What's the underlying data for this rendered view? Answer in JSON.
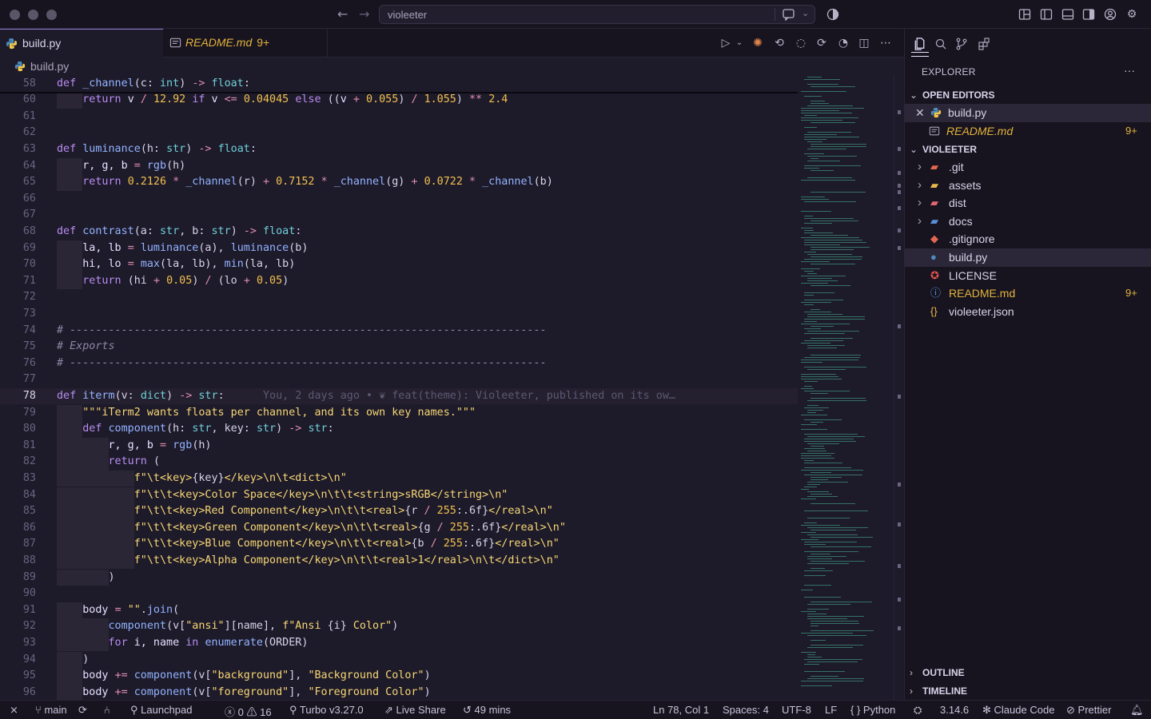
{
  "window": {
    "search_text": "violeeter"
  },
  "tabs": [
    {
      "label": "build.py",
      "active": true
    },
    {
      "label": "README.md",
      "badge": "9+",
      "active": false
    }
  ],
  "breadcrumb": {
    "file": "build.py"
  },
  "code_lines": [
    {
      "n": "58",
      "sticky": true,
      "html": "<span class=\"k\">def</span> <span class=\"f\">_channel</span><span class=\"p\">(c: </span><span class=\"b\">int</span><span class=\"p\">) </span><span class=\"o\">-&gt;</span> <span class=\"b\">float</span><span class=\"p\">:</span>"
    },
    {
      "n": "60",
      "html": "    <span class=\"k\">return</span> <span class=\"t\">v</span> <span class=\"o\">/</span> <span class=\"n\">12.92</span> <span class=\"k\">if</span> <span class=\"t\">v</span> <span class=\"o\">&lt;=</span> <span class=\"n\">0.04045</span> <span class=\"k\">else</span> <span class=\"p\">((</span><span class=\"t\">v</span> <span class=\"o\">+</span> <span class=\"n\">0.055</span><span class=\"p\">)</span> <span class=\"o\">/</span> <span class=\"n\">1.055</span><span class=\"p\">)</span> <span class=\"o\">**</span> <span class=\"n\">2.4</span>"
    },
    {
      "n": "61",
      "html": ""
    },
    {
      "n": "62",
      "html": ""
    },
    {
      "n": "63",
      "html": "<span class=\"k\">def</span> <span class=\"f\">luminance</span><span class=\"p\">(h: </span><span class=\"b\">str</span><span class=\"p\">) </span><span class=\"o\">-&gt;</span> <span class=\"b\">float</span><span class=\"p\">:</span>"
    },
    {
      "n": "64",
      "html": "    <span class=\"t\">r, g, b</span> <span class=\"o\">=</span> <span class=\"f\">rgb</span><span class=\"p\">(h)</span>"
    },
    {
      "n": "65",
      "html": "    <span class=\"k\">return</span> <span class=\"n\">0.2126</span> <span class=\"o\">*</span> <span class=\"f\">_channel</span><span class=\"p\">(r)</span> <span class=\"o\">+</span> <span class=\"n\">0.7152</span> <span class=\"o\">*</span> <span class=\"f\">_channel</span><span class=\"p\">(g)</span> <span class=\"o\">+</span> <span class=\"n\">0.0722</span> <span class=\"o\">*</span> <span class=\"f\">_channel</span><span class=\"p\">(b)</span>"
    },
    {
      "n": "66",
      "html": ""
    },
    {
      "n": "67",
      "html": ""
    },
    {
      "n": "68",
      "html": "<span class=\"k\">def</span> <span class=\"f\">contrast</span><span class=\"p\">(a: </span><span class=\"b\">str</span><span class=\"p\">, b: </span><span class=\"b\">str</span><span class=\"p\">) </span><span class=\"o\">-&gt;</span> <span class=\"b\">float</span><span class=\"p\">:</span>"
    },
    {
      "n": "69",
      "html": "    <span class=\"t\">la, lb</span> <span class=\"o\">=</span> <span class=\"f\">luminance</span><span class=\"p\">(a), </span><span class=\"f\">luminance</span><span class=\"p\">(b)</span>"
    },
    {
      "n": "70",
      "html": "    <span class=\"t\">hi, lo</span> <span class=\"o\">=</span> <span class=\"f\">max</span><span class=\"p\">(la, lb), </span><span class=\"f\">min</span><span class=\"p\">(la, lb)</span>"
    },
    {
      "n": "71",
      "html": "    <span class=\"k\">return</span> <span class=\"p\">(hi </span><span class=\"o\">+</span> <span class=\"n\">0.05</span><span class=\"p\">) </span><span class=\"o\">/</span> <span class=\"p\">(lo </span><span class=\"o\">+</span> <span class=\"n\">0.05</span><span class=\"p\">)</span>"
    },
    {
      "n": "72",
      "html": ""
    },
    {
      "n": "73",
      "html": ""
    },
    {
      "n": "74",
      "html": "<span class=\"c\"># --------------------------------------------------------------------------</span>"
    },
    {
      "n": "75",
      "html": "<span class=\"c\"># Exports</span>"
    },
    {
      "n": "76",
      "html": "<span class=\"c\"># --------------------------------------------------------------------------</span>"
    },
    {
      "n": "77",
      "html": ""
    },
    {
      "n": "78",
      "current": true,
      "html": "<span class=\"k\">def</span> <span class=\"f\">iterm</span><span class=\"p\">(v: </span><span class=\"b\">dict</span><span class=\"p\">) </span><span class=\"o\">-&gt;</span> <span class=\"b\">str</span><span class=\"p\">:</span>      <span class=\"blame\">You, 2 days ago • ❦ feat(theme): Violeeter, published on its ow…</span>"
    },
    {
      "n": "79",
      "html": "    <span class=\"s\">\"\"\"iTerm2 wants floats per channel, and its own key names.\"\"\"</span>"
    },
    {
      "n": "80",
      "html": "    <span class=\"k\">def</span> <span class=\"f\">component</span><span class=\"p\">(h: </span><span class=\"b\">str</span><span class=\"p\">, key: </span><span class=\"b\">str</span><span class=\"p\">) </span><span class=\"o\">-&gt;</span> <span class=\"b\">str</span><span class=\"p\">:</span>"
    },
    {
      "n": "81",
      "html": "        <span class=\"t\">r, g, b</span> <span class=\"o\">=</span> <span class=\"f\">rgb</span><span class=\"p\">(h)</span>"
    },
    {
      "n": "82",
      "html": "        <span class=\"k\">return</span> <span class=\"p\">(</span>"
    },
    {
      "n": "83",
      "html": "            <span class=\"s\">f\"\\t&lt;key&gt;</span><span class=\"p\">{key}</span><span class=\"s\">&lt;/key&gt;\\n\\t&lt;dict&gt;\\n\"</span>"
    },
    {
      "n": "84",
      "html": "            <span class=\"s\">f\"\\t\\t&lt;key&gt;Color Space&lt;/key&gt;\\n\\t\\t&lt;string&gt;sRGB&lt;/string&gt;\\n\"</span>"
    },
    {
      "n": "85",
      "html": "            <span class=\"s\">f\"\\t\\t&lt;key&gt;Red Component&lt;/key&gt;\\n\\t\\t&lt;real&gt;</span><span class=\"p\">{r </span><span class=\"o\">/</span> <span class=\"n\">255</span><span class=\"p\">:.6f}</span><span class=\"s\">&lt;/real&gt;\\n\"</span>"
    },
    {
      "n": "86",
      "html": "            <span class=\"s\">f\"\\t\\t&lt;key&gt;Green Component&lt;/key&gt;\\n\\t\\t&lt;real&gt;</span><span class=\"p\">{g </span><span class=\"o\">/</span> <span class=\"n\">255</span><span class=\"p\">:.6f}</span><span class=\"s\">&lt;/real&gt;\\n\"</span>"
    },
    {
      "n": "87",
      "html": "            <span class=\"s\">f\"\\t\\t&lt;key&gt;Blue Component&lt;/key&gt;\\n\\t\\t&lt;real&gt;</span><span class=\"p\">{b </span><span class=\"o\">/</span> <span class=\"n\">255</span><span class=\"p\">:.6f}</span><span class=\"s\">&lt;/real&gt;\\n\"</span>"
    },
    {
      "n": "88",
      "html": "            <span class=\"s\">f\"\\t\\t&lt;key&gt;Alpha Component&lt;/key&gt;\\n\\t\\t&lt;real&gt;1&lt;/real&gt;\\n\\t&lt;/dict&gt;\\n\"</span>"
    },
    {
      "n": "89",
      "html": "        <span class=\"p\">)</span>"
    },
    {
      "n": "90",
      "html": ""
    },
    {
      "n": "91",
      "html": "    <span class=\"t\">body</span> <span class=\"o\">=</span> <span class=\"s\">\"\"</span><span class=\"p\">.</span><span class=\"f\">join</span><span class=\"p\">(</span>"
    },
    {
      "n": "92",
      "html": "        <span class=\"f\">component</span><span class=\"p\">(v[</span><span class=\"s\">\"ansi\"</span><span class=\"p\">][name], </span><span class=\"s\">f\"Ansi </span><span class=\"p\">{i}</span><span class=\"s\"> Color\"</span><span class=\"p\">)</span>"
    },
    {
      "n": "93",
      "html": "        <span class=\"k\">for</span> <span class=\"t\">i, name</span> <span class=\"k\">in</span> <span class=\"f\">enumerate</span><span class=\"p\">(ORDER)</span>"
    },
    {
      "n": "94",
      "html": "    <span class=\"p\">)</span>"
    },
    {
      "n": "95",
      "html": "    <span class=\"t\">body</span> <span class=\"o\">+=</span> <span class=\"f\">component</span><span class=\"p\">(v[</span><span class=\"s\">\"background\"</span><span class=\"p\">], </span><span class=\"s\">\"Background Color\"</span><span class=\"p\">)</span>"
    },
    {
      "n": "96",
      "html": "    <span class=\"t\">body</span> <span class=\"o\">+=</span> <span class=\"f\">component</span><span class=\"p\">(v[</span><span class=\"s\">\"foreground\"</span><span class=\"p\">], </span><span class=\"s\">\"Foreground Color\"</span><span class=\"p\">)</span>"
    }
  ],
  "sidebar": {
    "title": "EXPLORER",
    "more": "···",
    "open_editors_label": "OPEN EDITORS",
    "open_editors": [
      {
        "label": "build.py",
        "icon": "python-icon",
        "selected": true
      },
      {
        "label": "README.md",
        "icon": "markdown-icon",
        "badge": "9+"
      }
    ],
    "project_label": "VIOLEETER",
    "tree": [
      {
        "label": ".git",
        "type": "folder",
        "icon": "git-folder-icon",
        "color": "#e2674f"
      },
      {
        "label": "assets",
        "type": "folder",
        "icon": "folder-icon",
        "color": "#e8b84a"
      },
      {
        "label": "dist",
        "type": "folder",
        "icon": "dist-folder-icon",
        "color": "#e0686f"
      },
      {
        "label": "docs",
        "type": "folder",
        "icon": "docs-folder-icon",
        "color": "#5a8fd8"
      },
      {
        "label": ".gitignore",
        "type": "file",
        "icon": "git-icon",
        "color": "#e2674f"
      },
      {
        "label": "build.py",
        "type": "file",
        "icon": "python-icon",
        "color": "#4b8bbe",
        "selected": true
      },
      {
        "label": "LICENSE",
        "type": "file",
        "icon": "license-icon",
        "color": "#e8574f"
      },
      {
        "label": "README.md",
        "type": "file",
        "icon": "info-icon",
        "color": "#5a9ae8",
        "badge": "9+",
        "modified": true
      },
      {
        "label": "violeeter.json",
        "type": "file",
        "icon": "json-icon",
        "color": "#e8b84a"
      }
    ],
    "outline_label": "OUTLINE",
    "timeline_label": "TIMELINE"
  },
  "status": {
    "branch": "main",
    "launchpad": "Launchpad",
    "errors": "0",
    "warnings": "16",
    "turbo": "Turbo v3.27.0",
    "live_share": "Live Share",
    "time": "49 mins",
    "position": "Ln 78, Col 1",
    "spaces": "Spaces: 4",
    "encoding": "UTF-8",
    "eol": "LF",
    "language": "Python",
    "version": "3.14.6",
    "claude": "Claude Code",
    "prettier": "Prettier"
  },
  "colors": {
    "accent": "#8a7cc9",
    "badge": "#e3b23c",
    "keyword": "#b98cf0",
    "string": "#f7d774"
  }
}
